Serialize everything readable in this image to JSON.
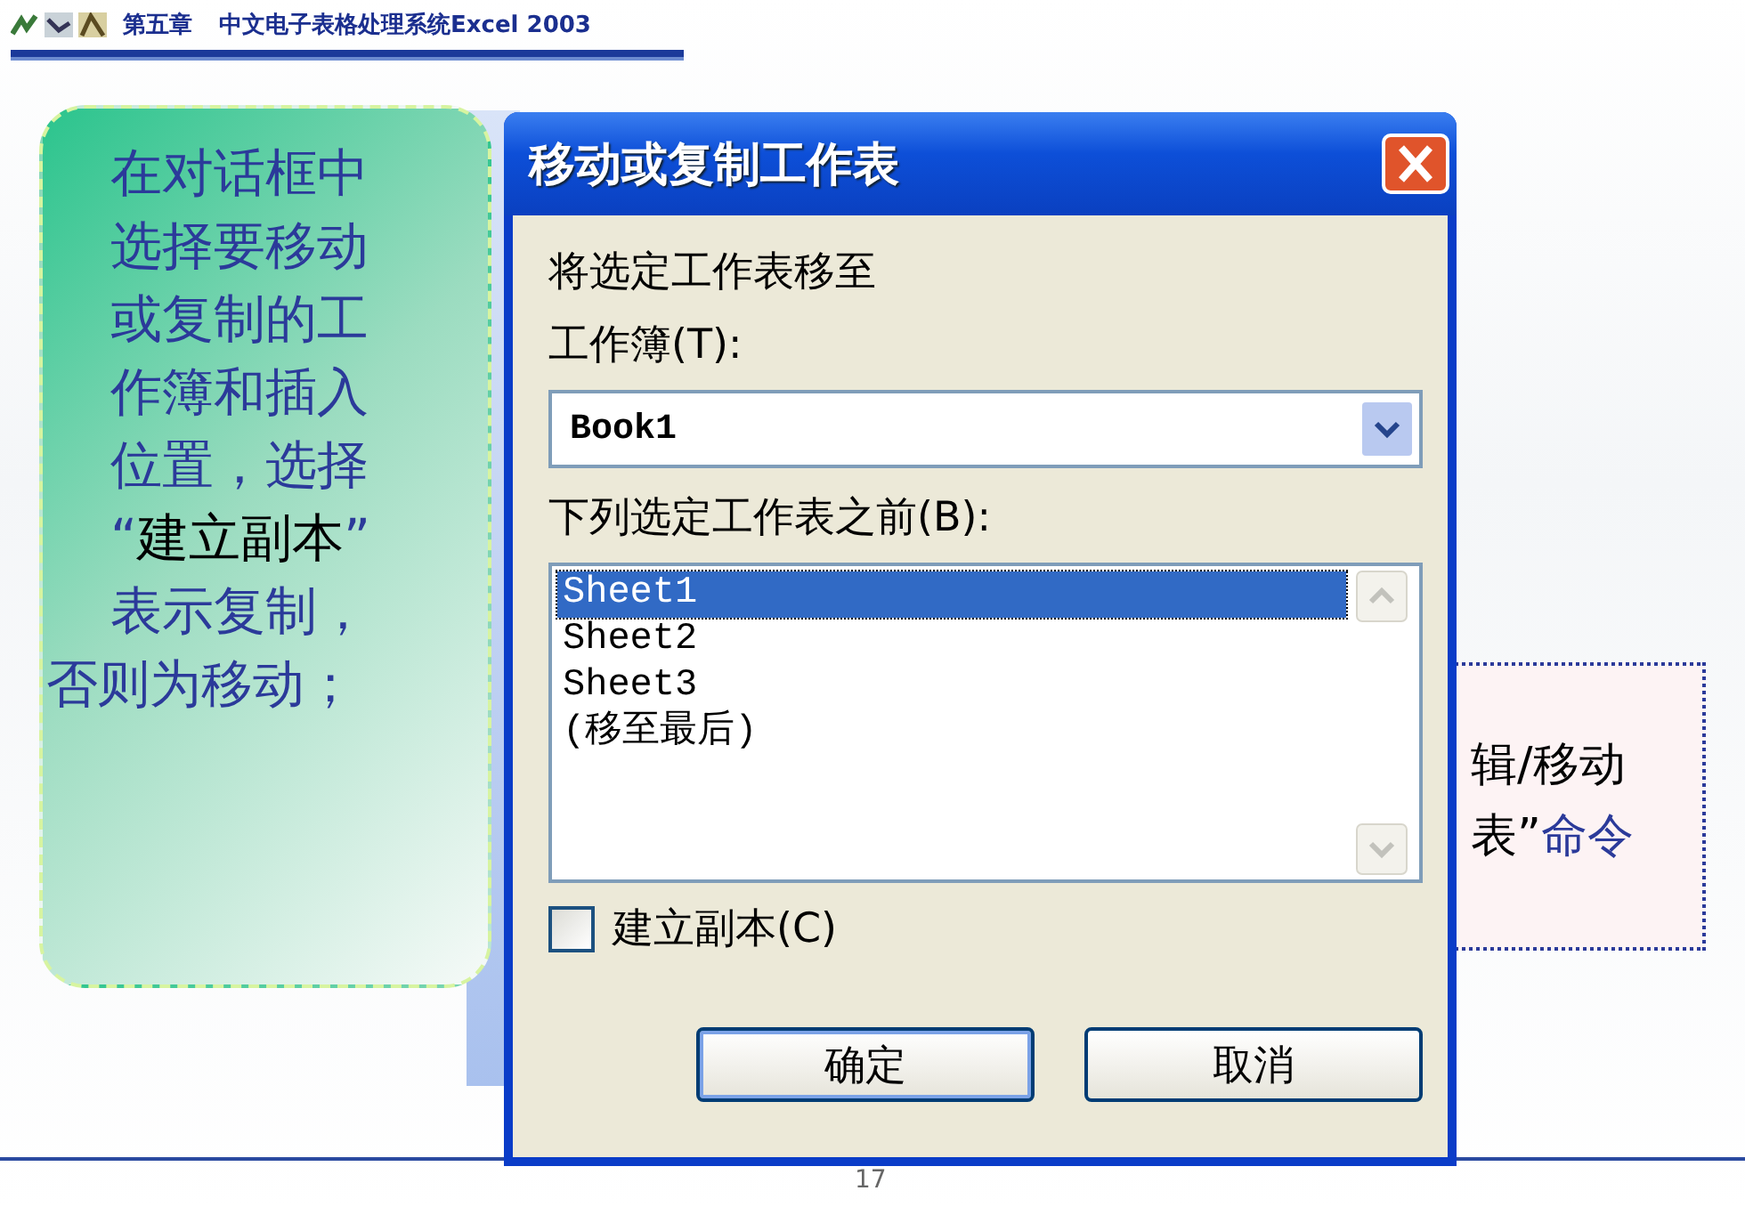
{
  "header": {
    "chapter": "第五章",
    "title": "中文电子表格处理系统Excel 2003"
  },
  "callout": {
    "lines": [
      [
        {
          "text": "在对话框中",
          "emphasis": false
        }
      ],
      [
        {
          "text": "选择要移动",
          "emphasis": false
        }
      ],
      [
        {
          "text": "或复制的工",
          "emphasis": false
        }
      ],
      [
        {
          "text": "作簿和插入",
          "emphasis": false
        }
      ],
      [
        {
          "text": "位置，选择",
          "emphasis": false
        }
      ],
      [
        {
          "text": "“",
          "emphasis": false
        },
        {
          "text": "建立副本",
          "emphasis": true
        },
        {
          "text": "”",
          "emphasis": false
        }
      ],
      [
        {
          "text": "表示复制，",
          "emphasis": false
        }
      ],
      [
        {
          "text": "否则为移动；",
          "emphasis": false
        }
      ]
    ]
  },
  "dialog": {
    "title": "移动或复制工作表",
    "move_label": "将选定工作表移至",
    "workbook_label": "工作簿(T):",
    "workbook_value": "Book1",
    "before_label": "下列选定工作表之前(B):",
    "sheets": [
      {
        "label": "Sheet1",
        "selected": true
      },
      {
        "label": "Sheet2",
        "selected": false
      },
      {
        "label": "Sheet3",
        "selected": false
      },
      {
        "label": "(移至最后)",
        "selected": false
      }
    ],
    "copy_checkbox": {
      "label": "建立副本(C)",
      "checked": false
    },
    "buttons": [
      "确定",
      "取消"
    ]
  },
  "note": {
    "lines": [
      [
        {
          "text": "辑/移动",
          "emphasis": false
        }
      ],
      [
        {
          "text": "表”",
          "emphasis": false
        },
        {
          "text": "命令",
          "emphasis": true
        }
      ]
    ]
  },
  "page_number": "17"
}
